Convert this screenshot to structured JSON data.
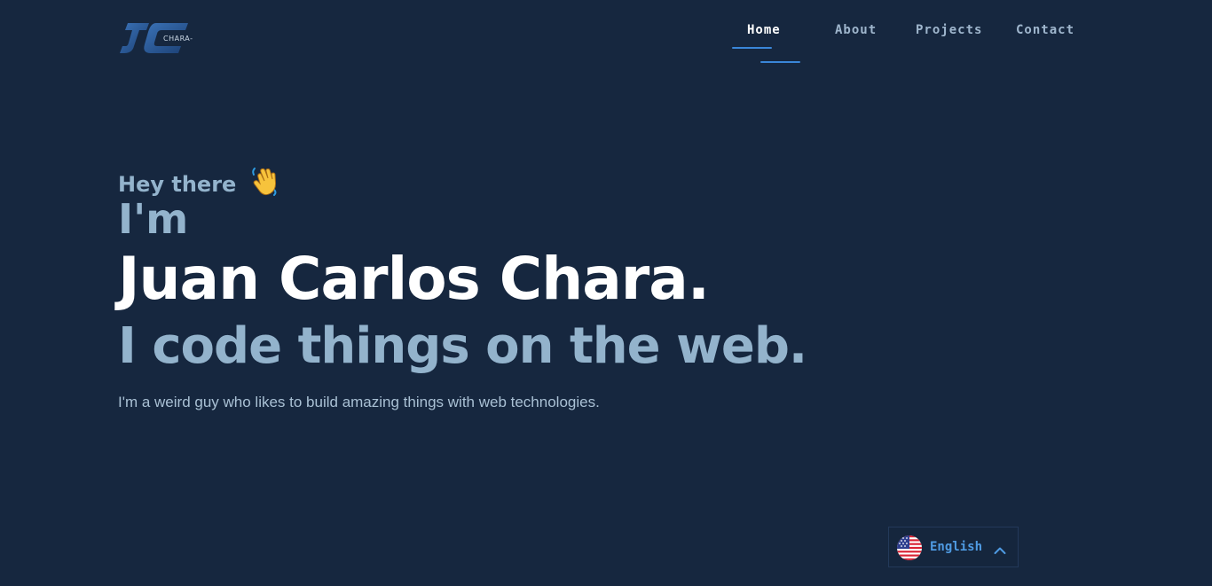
{
  "logo": {
    "text": "CHARA-",
    "mark": "jc-monogram"
  },
  "nav": {
    "items": [
      {
        "label": "Home",
        "active": true
      },
      {
        "label": "About",
        "active": false
      },
      {
        "label": "Projects",
        "active": false
      },
      {
        "label": "Contact",
        "active": false
      }
    ]
  },
  "hero": {
    "greeting": "Hey there",
    "greeting_icon": "waving-hand-icon",
    "intro": "I'm",
    "name": "Juan Carlos Chara.",
    "tagline": "I code things on the web.",
    "description": "I'm a weird guy who likes to build amazing things with web technologies."
  },
  "language": {
    "label": "English",
    "flag_icon": "us-flag-icon",
    "toggle_icon": "chevron-up-icon"
  },
  "colors": {
    "background": "#16273f",
    "accent": "#3a86d8",
    "muted_text": "#93b3cc",
    "heading": "#ffffff",
    "nav_text": "#9fb6cd",
    "lang_text": "#4f9be3"
  }
}
